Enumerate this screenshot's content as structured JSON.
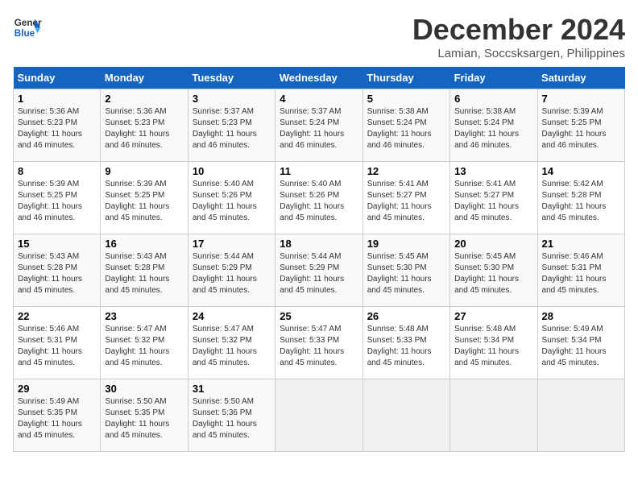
{
  "header": {
    "logo_general": "General",
    "logo_blue": "Blue",
    "title": "December 2024",
    "subtitle": "Lamian, Soccsksargen, Philippines"
  },
  "weekdays": [
    "Sunday",
    "Monday",
    "Tuesday",
    "Wednesday",
    "Thursday",
    "Friday",
    "Saturday"
  ],
  "weeks": [
    [
      {
        "day": "1",
        "sunrise": "5:36 AM",
        "sunset": "5:23 PM",
        "daylight": "11 hours and 46 minutes."
      },
      {
        "day": "2",
        "sunrise": "5:36 AM",
        "sunset": "5:23 PM",
        "daylight": "11 hours and 46 minutes."
      },
      {
        "day": "3",
        "sunrise": "5:37 AM",
        "sunset": "5:23 PM",
        "daylight": "11 hours and 46 minutes."
      },
      {
        "day": "4",
        "sunrise": "5:37 AM",
        "sunset": "5:24 PM",
        "daylight": "11 hours and 46 minutes."
      },
      {
        "day": "5",
        "sunrise": "5:38 AM",
        "sunset": "5:24 PM",
        "daylight": "11 hours and 46 minutes."
      },
      {
        "day": "6",
        "sunrise": "5:38 AM",
        "sunset": "5:24 PM",
        "daylight": "11 hours and 46 minutes."
      },
      {
        "day": "7",
        "sunrise": "5:39 AM",
        "sunset": "5:25 PM",
        "daylight": "11 hours and 46 minutes."
      }
    ],
    [
      {
        "day": "8",
        "sunrise": "5:39 AM",
        "sunset": "5:25 PM",
        "daylight": "11 hours and 46 minutes."
      },
      {
        "day": "9",
        "sunrise": "5:39 AM",
        "sunset": "5:25 PM",
        "daylight": "11 hours and 45 minutes."
      },
      {
        "day": "10",
        "sunrise": "5:40 AM",
        "sunset": "5:26 PM",
        "daylight": "11 hours and 45 minutes."
      },
      {
        "day": "11",
        "sunrise": "5:40 AM",
        "sunset": "5:26 PM",
        "daylight": "11 hours and 45 minutes."
      },
      {
        "day": "12",
        "sunrise": "5:41 AM",
        "sunset": "5:27 PM",
        "daylight": "11 hours and 45 minutes."
      },
      {
        "day": "13",
        "sunrise": "5:41 AM",
        "sunset": "5:27 PM",
        "daylight": "11 hours and 45 minutes."
      },
      {
        "day": "14",
        "sunrise": "5:42 AM",
        "sunset": "5:28 PM",
        "daylight": "11 hours and 45 minutes."
      }
    ],
    [
      {
        "day": "15",
        "sunrise": "5:43 AM",
        "sunset": "5:28 PM",
        "daylight": "11 hours and 45 minutes."
      },
      {
        "day": "16",
        "sunrise": "5:43 AM",
        "sunset": "5:28 PM",
        "daylight": "11 hours and 45 minutes."
      },
      {
        "day": "17",
        "sunrise": "5:44 AM",
        "sunset": "5:29 PM",
        "daylight": "11 hours and 45 minutes."
      },
      {
        "day": "18",
        "sunrise": "5:44 AM",
        "sunset": "5:29 PM",
        "daylight": "11 hours and 45 minutes."
      },
      {
        "day": "19",
        "sunrise": "5:45 AM",
        "sunset": "5:30 PM",
        "daylight": "11 hours and 45 minutes."
      },
      {
        "day": "20",
        "sunrise": "5:45 AM",
        "sunset": "5:30 PM",
        "daylight": "11 hours and 45 minutes."
      },
      {
        "day": "21",
        "sunrise": "5:46 AM",
        "sunset": "5:31 PM",
        "daylight": "11 hours and 45 minutes."
      }
    ],
    [
      {
        "day": "22",
        "sunrise": "5:46 AM",
        "sunset": "5:31 PM",
        "daylight": "11 hours and 45 minutes."
      },
      {
        "day": "23",
        "sunrise": "5:47 AM",
        "sunset": "5:32 PM",
        "daylight": "11 hours and 45 minutes."
      },
      {
        "day": "24",
        "sunrise": "5:47 AM",
        "sunset": "5:32 PM",
        "daylight": "11 hours and 45 minutes."
      },
      {
        "day": "25",
        "sunrise": "5:47 AM",
        "sunset": "5:33 PM",
        "daylight": "11 hours and 45 minutes."
      },
      {
        "day": "26",
        "sunrise": "5:48 AM",
        "sunset": "5:33 PM",
        "daylight": "11 hours and 45 minutes."
      },
      {
        "day": "27",
        "sunrise": "5:48 AM",
        "sunset": "5:34 PM",
        "daylight": "11 hours and 45 minutes."
      },
      {
        "day": "28",
        "sunrise": "5:49 AM",
        "sunset": "5:34 PM",
        "daylight": "11 hours and 45 minutes."
      }
    ],
    [
      {
        "day": "29",
        "sunrise": "5:49 AM",
        "sunset": "5:35 PM",
        "daylight": "11 hours and 45 minutes."
      },
      {
        "day": "30",
        "sunrise": "5:50 AM",
        "sunset": "5:35 PM",
        "daylight": "11 hours and 45 minutes."
      },
      {
        "day": "31",
        "sunrise": "5:50 AM",
        "sunset": "5:36 PM",
        "daylight": "11 hours and 45 minutes."
      },
      null,
      null,
      null,
      null
    ]
  ]
}
